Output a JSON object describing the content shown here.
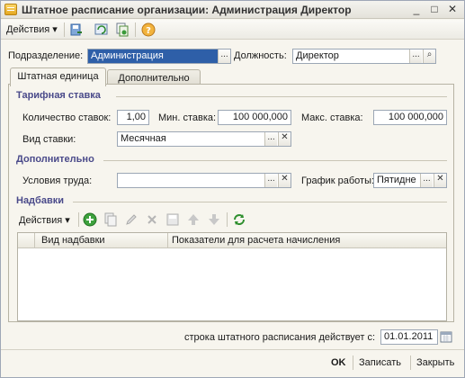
{
  "window": {
    "title": "Штатное расписание организации: Администрация Директор",
    "min_glyph": "_",
    "max_glyph": "□",
    "close_glyph": "✕"
  },
  "toolbar": {
    "actions_label": "Действия",
    "dropdown_glyph": "▾"
  },
  "header": {
    "department_label": "Подразделение:",
    "department_value": "Администрация",
    "position_label": "Должность:",
    "position_value": "Директор"
  },
  "tabs": [
    {
      "label": "Штатная единица",
      "active": true
    },
    {
      "label": "Дополнительно",
      "active": false
    }
  ],
  "rate": {
    "section_title": "Тарифная ставка",
    "count_label": "Количество ставок:",
    "count_value": "1,00",
    "min_label": "Мин. ставка:",
    "min_value": "100 000,000",
    "max_label": "Макс. ставка:",
    "max_value": "100 000,000",
    "kind_label": "Вид ставки:",
    "kind_value": "Месячная"
  },
  "extra": {
    "section_title": "Дополнительно",
    "conditions_label": "Условия труда:",
    "conditions_value": "",
    "schedule_label": "График работы:",
    "schedule_value": "Пятидне"
  },
  "allowances": {
    "section_title": "Надбавки",
    "actions_label": "Действия",
    "columns": [
      "Вид надбавки",
      "Показатели для расчета начисления"
    ]
  },
  "footer": {
    "effective_label": "строка штатного расписания действует с:",
    "effective_date": "01.01.2011",
    "ok_label": "OK",
    "save_label": "Записать",
    "close_label": "Закрыть"
  },
  "glyphs": {
    "ellipsis": "...",
    "clear": "✕",
    "search": "⌕"
  },
  "colors": {
    "section_title": "#4a4a8a",
    "selection": "#2e5fa8"
  }
}
